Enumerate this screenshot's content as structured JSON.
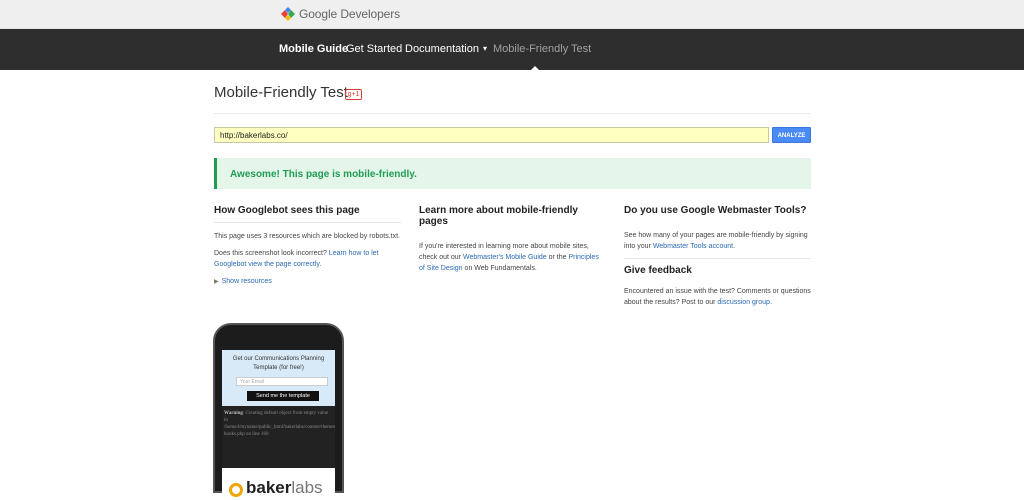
{
  "header": {
    "logo_text": "Google Developers"
  },
  "nav": {
    "items": [
      {
        "label": "Mobile Guide"
      },
      {
        "label": "Get Started"
      },
      {
        "label": "Documentation"
      },
      {
        "label": "Mobile-Friendly Test"
      }
    ]
  },
  "page": {
    "title": "Mobile-Friendly Test",
    "gplus_label": "g+1"
  },
  "form": {
    "url_value": "http://bakerlabs.co/",
    "analyze_label": "ANALYZE"
  },
  "result": {
    "message": "Awesome! This page is mobile-friendly."
  },
  "col1": {
    "heading": "How Googlebot sees this page",
    "p1": "This page uses 3 resources which are blocked by robots.txt.",
    "p2_text": "Does this screenshot look incorrect?",
    "p2_link": "Learn how to let Googlebot view the page correctly.",
    "show_resources": "Show resources"
  },
  "col2": {
    "heading": "Learn more about mobile-friendly pages",
    "p_text1": "If you're interested in learning more about mobile sites, check out our",
    "link1": "Webmaster's Mobile Guide",
    "p_text2": "or the",
    "link2": "Principles of Site Design",
    "p_text3": "on Web Fundamentals."
  },
  "col3": {
    "heading": "Do you use Google Webmaster Tools?",
    "p_text1": "See how many of your pages are mobile-friendly by signing into your",
    "link1": "Webmaster Tools account",
    "p_text1_end": ".",
    "feedback_heading": "Give feedback",
    "p_text2": "Encountered an issue with the test? Comments or questions about the results? Post to our",
    "link2": "discussion group",
    "p_text2_end": "."
  },
  "preview": {
    "promo_text": "Get our Communications Planning Template (for free!)",
    "email_placeholder": "Your Email",
    "button_label": "Send me the template",
    "warning_label": "Warning",
    "warning_text": ": Creating default object from empty value in /home4/myname/public_html/bakerlabs/content/themes/whitelight/functions/admin-hooks.php on line 160",
    "brand_bold": "baker",
    "brand_light": "labs"
  },
  "colors": {
    "nav_bg": "#2e2e2e",
    "success_green": "#1f9d55",
    "success_bg": "#e4f5ea",
    "link": "#2a6ab4",
    "analyze_blue": "#4a8af4"
  }
}
